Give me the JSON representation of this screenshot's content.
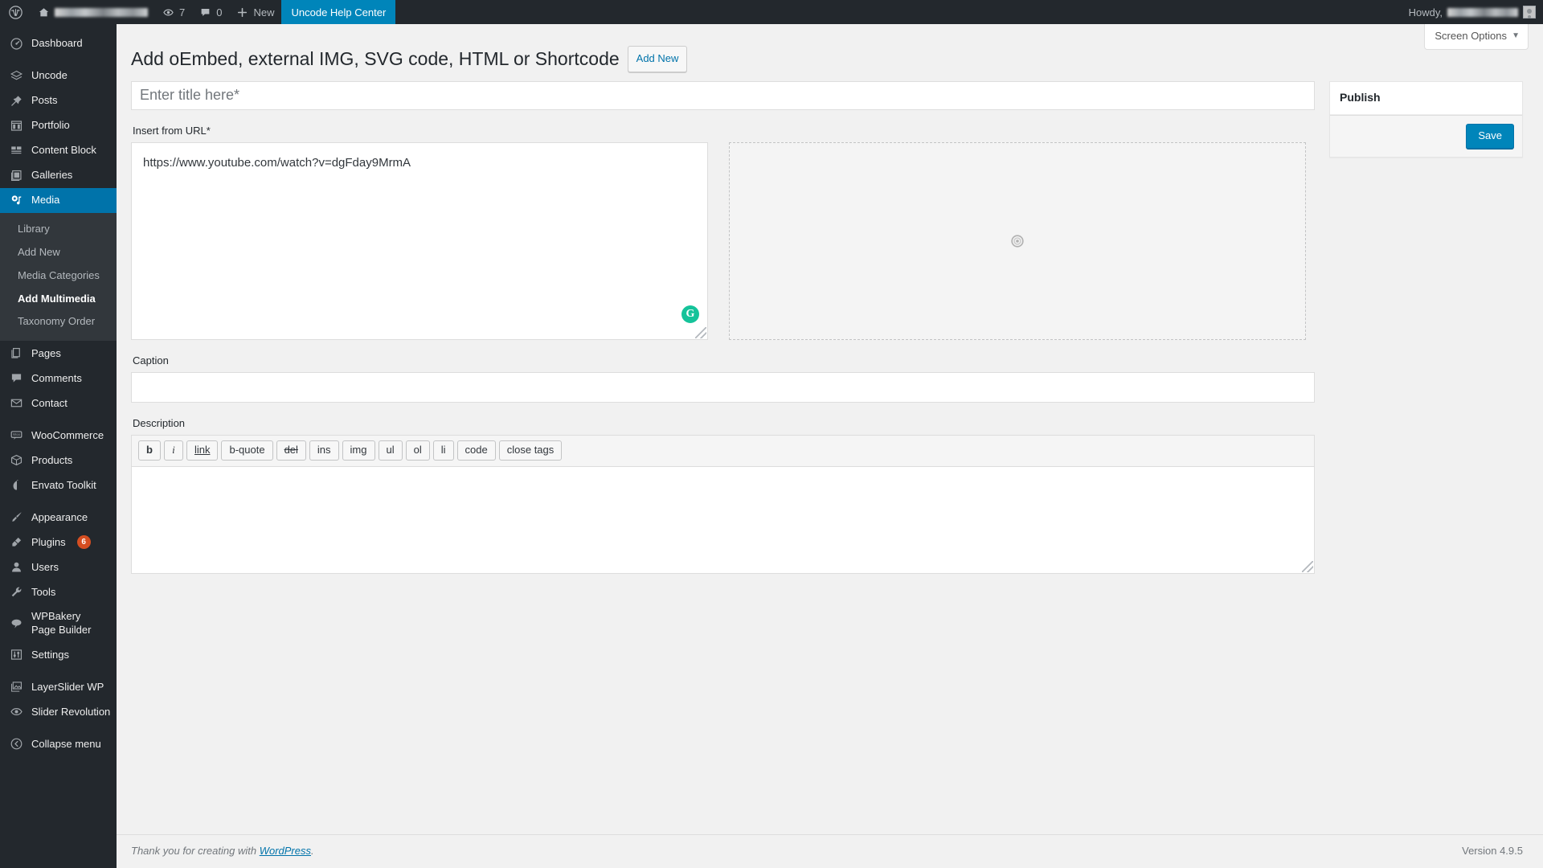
{
  "adminbar": {
    "logo_icon": "wordpress-logo-icon",
    "site_icon": "home-icon",
    "site_name_redacted": "",
    "updates_icon": "updates-icon",
    "updates_count": "7",
    "comments_icon": "comment-bubble-icon",
    "comments_count": "0",
    "new_icon": "plus-icon",
    "new_label": "New",
    "help_center_label": "Uncode Help Center",
    "howdy_label": "Howdy,",
    "user_name_redacted": "",
    "avatar_icon": "avatar-icon"
  },
  "screen_options": {
    "label": "Screen Options",
    "caret": "▼"
  },
  "sidebar": {
    "items": [
      {
        "label": "Dashboard",
        "icon": "dashboard-icon"
      },
      {
        "label": "Uncode",
        "icon": "layers-icon"
      },
      {
        "label": "Posts",
        "icon": "pin-icon"
      },
      {
        "label": "Portfolio",
        "icon": "portfolio-grid-icon"
      },
      {
        "label": "Content Block",
        "icon": "content-block-icon"
      },
      {
        "label": "Galleries",
        "icon": "gallery-icon"
      },
      {
        "label": "Media",
        "icon": "media-icon",
        "current": true
      },
      {
        "label": "Pages",
        "icon": "pages-icon"
      },
      {
        "label": "Comments",
        "icon": "comments-icon"
      },
      {
        "label": "Contact",
        "icon": "envelope-icon"
      },
      {
        "label": "WooCommerce",
        "icon": "woocommerce-icon"
      },
      {
        "label": "Products",
        "icon": "products-box-icon"
      },
      {
        "label": "Envato Toolkit",
        "icon": "envato-leaf-icon"
      },
      {
        "label": "Appearance",
        "icon": "paintbrush-icon"
      },
      {
        "label": "Plugins",
        "icon": "plug-icon",
        "badge": "6"
      },
      {
        "label": "Users",
        "icon": "user-icon"
      },
      {
        "label": "Tools",
        "icon": "wrench-icon"
      },
      {
        "label": "WPBakery Page Builder",
        "icon": "wpbakery-icon"
      },
      {
        "label": "Settings",
        "icon": "settings-sliders-icon"
      },
      {
        "label": "LayerSlider WP",
        "icon": "layerslider-icon"
      },
      {
        "label": "Slider Revolution",
        "icon": "slider-revolution-icon"
      },
      {
        "label": "Collapse menu",
        "icon": "collapse-arrow-icon"
      }
    ],
    "media_submenu": [
      {
        "label": "Library"
      },
      {
        "label": "Add New"
      },
      {
        "label": "Media Categories"
      },
      {
        "label": "Add Multimedia",
        "current": true
      },
      {
        "label": "Taxonomy Order"
      }
    ]
  },
  "page": {
    "title": "Add oEmbed, external IMG, SVG code, HTML or Shortcode",
    "add_new_label": "Add New"
  },
  "form": {
    "title_placeholder": "Enter title here*",
    "insert_from_url_label": "Insert from URL*",
    "url_value": "https://www.youtube.com/watch?v=dgFday9MrmA",
    "grammarly_badge": "G",
    "preview_icon": "loading-spinner-icon",
    "caption_label": "Caption",
    "caption_value": "",
    "description_label": "Description",
    "description_value": "",
    "quicktags": [
      "b",
      "i",
      "link",
      "b-quote",
      "del",
      "ins",
      "img",
      "ul",
      "ol",
      "li",
      "code",
      "close tags"
    ]
  },
  "publish_box": {
    "title": "Publish",
    "save_label": "Save"
  },
  "footer": {
    "thanks_prefix": "Thank you for creating with ",
    "wordpress_link": "WordPress",
    "thanks_suffix": ".",
    "version": "Version 4.9.5"
  },
  "colors": {
    "admin_bar": "#23282d",
    "sidebar": "#23282d",
    "accent_blue": "#0073aa",
    "button_blue": "#0085ba",
    "badge_orange": "#d54e21",
    "grammarly_green": "#15c39a"
  }
}
